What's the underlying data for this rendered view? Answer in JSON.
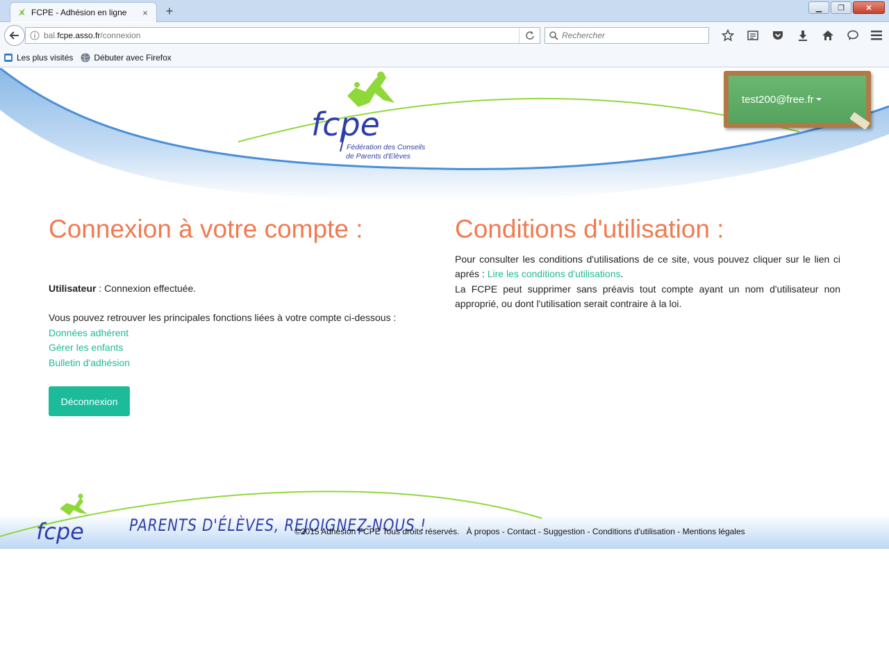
{
  "browser": {
    "tab_title": "FCPE - Adhésion en ligne",
    "tab_close": "×",
    "new_tab": "+",
    "url_prefix": "bal.",
    "url_domain": "fcpe.asso.fr",
    "url_path": "/connexion",
    "search_placeholder": "Rechercher",
    "bookmarks": [
      "Les plus visités",
      "Débuter avec Firefox"
    ]
  },
  "header": {
    "logo_text": "fcpe",
    "logo_line1": "Fédération des Conseils",
    "logo_line2": "de Parents d'Elèves",
    "user_email": "test200@free.fr"
  },
  "login": {
    "title": "Connexion à votre compte :",
    "user_label": "Utilisateur",
    "user_status": " : Connexion effectuée.",
    "intro": "Vous pouvez retrouver les principales fonctions liées à votre compte ci-dessous :",
    "links": [
      "Données adhérent",
      "Gérer les enfants",
      "Bulletin d'adhésion"
    ],
    "logout_label": "Déconnexion"
  },
  "conditions": {
    "title": "Conditions d'utilisation :",
    "para1": "Pour consulter les conditions d'utilisations de ce site, vous pouvez cliquer sur le lien ci aprés : ",
    "link": "Lire les conditions d'utilisations",
    "para1_end": ".",
    "para2": "La FCPE peut supprimer sans préavis tout compte ayant un nom d'utilisateur non approprié, ou dont l'utilisation serait contraire à la loi."
  },
  "footer": {
    "logo_text": "fcpe",
    "slogan": "PARENTS D'ÉLÈVES, REJOIGNEZ-NOUS !",
    "copyright": "©2015 Adhésion FCPE Tous droits réservés.",
    "links": [
      "À propos",
      "Contact",
      "Suggestion",
      "Conditions d'utilisation",
      "Mentions légales"
    ]
  }
}
